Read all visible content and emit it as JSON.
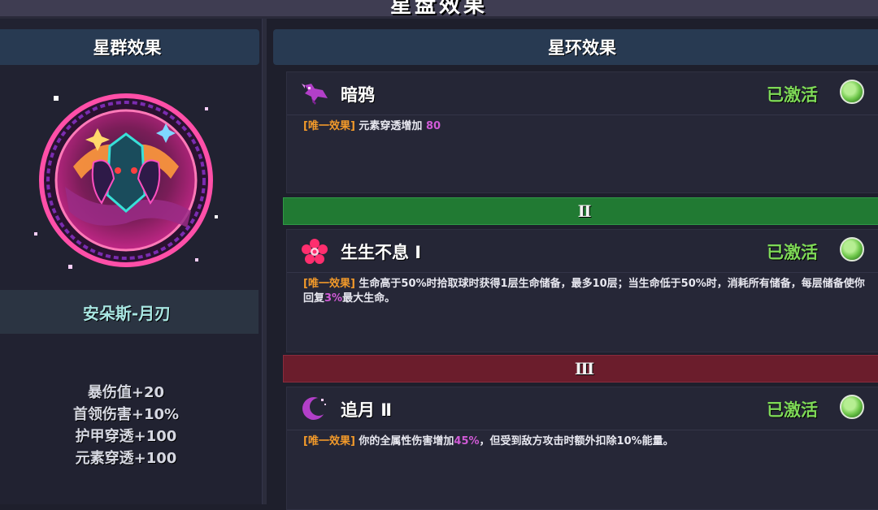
{
  "top": {
    "title": "星盘效果"
  },
  "left": {
    "header": "星群效果",
    "name": "安朵斯-月刃",
    "stats": [
      "暴伤值+20",
      "首领伤害+10%",
      "护甲穿透+100",
      "元素穿透+100"
    ]
  },
  "right": {
    "header": "星环效果",
    "tiers": [
      "Ⅱ",
      "Ⅲ"
    ],
    "cards": [
      {
        "title": "暗鸦",
        "icon": "crow-icon",
        "status": "已激活",
        "tag": "[唯一效果]",
        "desc_1": " 元素穿透增加 ",
        "hl_1": "80",
        "desc_2": ""
      },
      {
        "title": "生生不息 Ⅰ",
        "icon": "flower-icon",
        "status": "已激活",
        "tag": "[唯一效果]",
        "desc_1": " 生命高于50%时拾取球时获得1层生命储备，最多10层；当生命低于50%时，消耗所有储备，每层储备使你回复",
        "hl_1": "3%",
        "desc_2": "最大生命。"
      },
      {
        "title": "追月 Ⅱ",
        "icon": "crescent-moon-icon",
        "status": "已激活",
        "tag": "[唯一效果]",
        "desc_1": " 你的全属性伤害增加",
        "hl_1": "45%",
        "desc_2": "，但受到敌方攻击时额外扣除10%能量。"
      }
    ]
  },
  "colors": {
    "active": "#7ed957",
    "tag": "#f39a2a",
    "highlight": "#d05ad6",
    "tier2": "#217a33",
    "tier3": "#6b1d2c",
    "header": "#283a52"
  }
}
